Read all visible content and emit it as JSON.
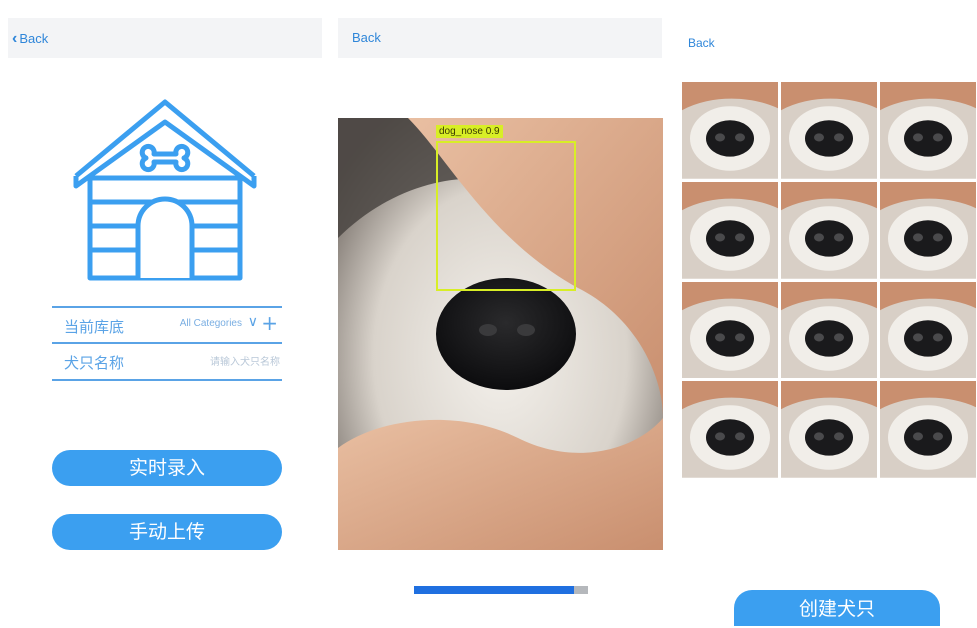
{
  "panel1": {
    "back_label": "Back",
    "rows": [
      {
        "label": "当前库底",
        "value": "All Categories"
      },
      {
        "label": "犬只名称",
        "placeholder": "请输入犬只名称"
      }
    ],
    "buttons": [
      "实时录入",
      "手动上传"
    ],
    "colors": {
      "accent": "#3b9ff0",
      "line": "#5aa3e6"
    }
  },
  "panel2": {
    "back_label": "Back",
    "detection": {
      "label": "dog_nose 0.9"
    },
    "progress": 0.92
  },
  "panel3": {
    "back_label": "Back",
    "thumbnail_count": 12,
    "create_button": "创建犬只"
  },
  "icons": [
    "doghouse-icon",
    "chevron-left-icon",
    "chevron-down-icon",
    "plus-icon"
  ]
}
